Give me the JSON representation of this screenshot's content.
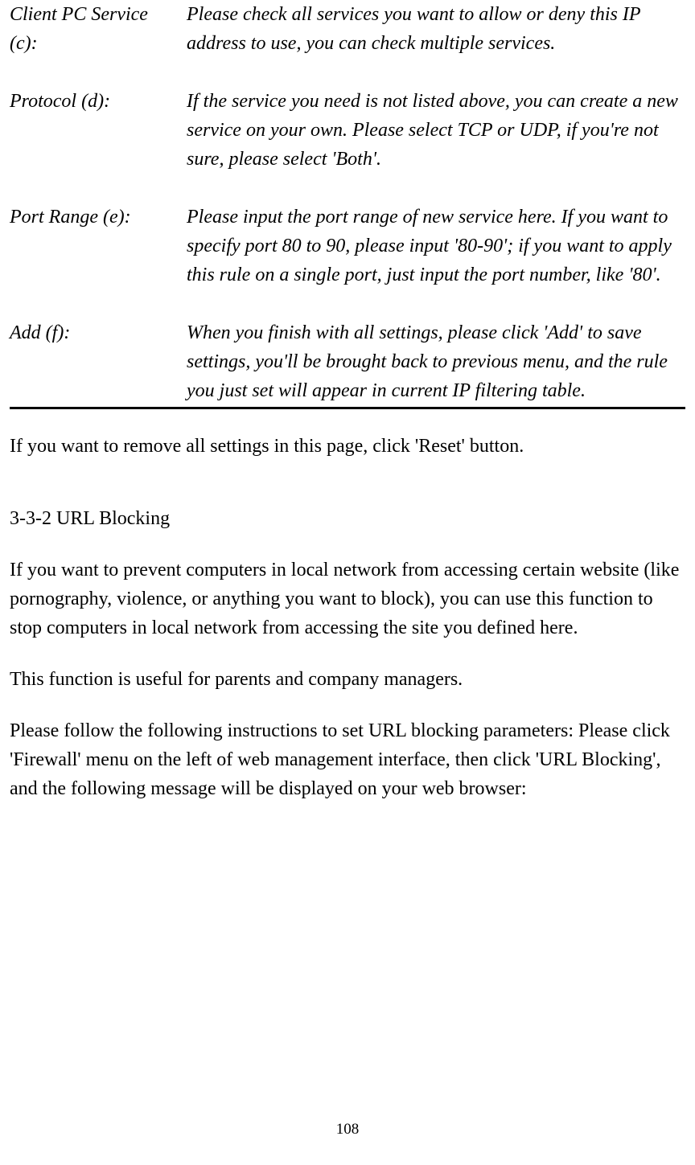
{
  "definitions": {
    "clientPC": {
      "term": "Client PC Service (c):",
      "desc": "Please check all services you want to allow or deny this IP address to use, you can check multiple services."
    },
    "protocol": {
      "term": "Protocol (d):",
      "desc": "If the service you need is not listed above, you can create a new service on your own. Please select TCP or UDP, if you're not sure, please select 'Both'."
    },
    "portRange": {
      "term": "Port Range (e):",
      "desc": "Please input the port range of new service here. If you want to specify port 80 to 90, please input '80-90'; if you want to apply this rule on a single port, just input the port number, like '80'."
    },
    "add": {
      "term": "Add (f):",
      "desc": "When you finish with all settings, please click 'Add' to save settings, you'll be brought back to previous menu, and the rule you just set will appear in current IP filtering table."
    }
  },
  "resetNote": "If you want to remove all settings in this page, click 'Reset' button.",
  "sectionHeading": "3-3-2 URL Blocking",
  "urlBlockingIntro": "If you want to prevent computers in local network from accessing certain website (like pornography, violence, or anything you want to block), you can use this function to stop computers in local network from accessing the site you defined here.",
  "usefulFor": "This function is useful for parents and company managers.",
  "instructions": "Please follow the following instructions to set URL blocking parameters: Please click 'Firewall' menu on the left of web management interface, then click 'URL Blocking', and the following message will be displayed on your web browser:",
  "pageNumber": "108"
}
